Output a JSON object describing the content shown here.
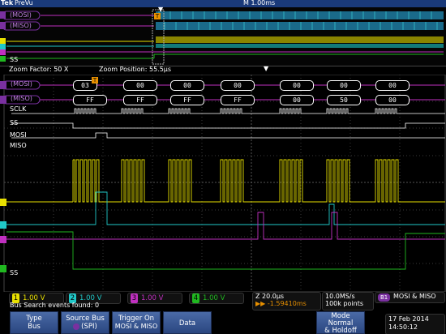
{
  "header": {
    "brand": "Tek",
    "mode": "PreVu",
    "timebase": "M 1.00ms"
  },
  "overview": {
    "bus_mosi_label": "(MOSI)",
    "bus_miso_label": "(MISO)",
    "ss_label": "SS",
    "trigger_marker": "T"
  },
  "zoom_info": {
    "factor": "Zoom Factor: 50 X",
    "position": "Zoom Position: 55.5µs"
  },
  "zoom": {
    "mosi_label": "(MOSI)",
    "miso_label": "(MISO)",
    "mosi_values": [
      "03",
      "00",
      "00",
      "00",
      "00",
      "00",
      "00"
    ],
    "miso_values": [
      "FF",
      "FF",
      "FF",
      "FF",
      "00",
      "50",
      "00"
    ],
    "sclk_label": "SCLK",
    "ss_label": "SS",
    "mosi_line_label": "MOSI",
    "miso_line_label": "MISO",
    "ss_bottom_label": "SS",
    "trigger_marker": "T"
  },
  "status": {
    "ch1": "1.00 V",
    "ch2": "1.00 V",
    "ch3": "1.00 V",
    "ch4": "1.00 V",
    "search": "Bus Search events found: 0",
    "zoom_time": "Z 20.0µs",
    "trigger_pos": "▶▶ -1.59410ms",
    "sample_rate": "10.0MS/s",
    "points": "100k points",
    "bus_label": "B1",
    "bus_trigger": "MOSI & MISO"
  },
  "menu": {
    "type_label": "Type",
    "type_value": "Bus",
    "source_label": "Source Bus",
    "source_value": "(SPI)",
    "trigger_on_label": "Trigger On",
    "trigger_on_value": "MOSI & MISO",
    "data_label": "Data",
    "mode_label": "Mode",
    "mode_value": "Normal",
    "mode_value2": "& Holdoff"
  },
  "datetime": {
    "date": "17 Feb  2014",
    "time": "14:50:12"
  },
  "colors": {
    "ch1": "#e8e000",
    "ch2": "#20c8c8",
    "ch3": "#c030c0",
    "ch4": "#20b820",
    "bus": "#7a30a0",
    "grid": "#3a3a3a"
  }
}
